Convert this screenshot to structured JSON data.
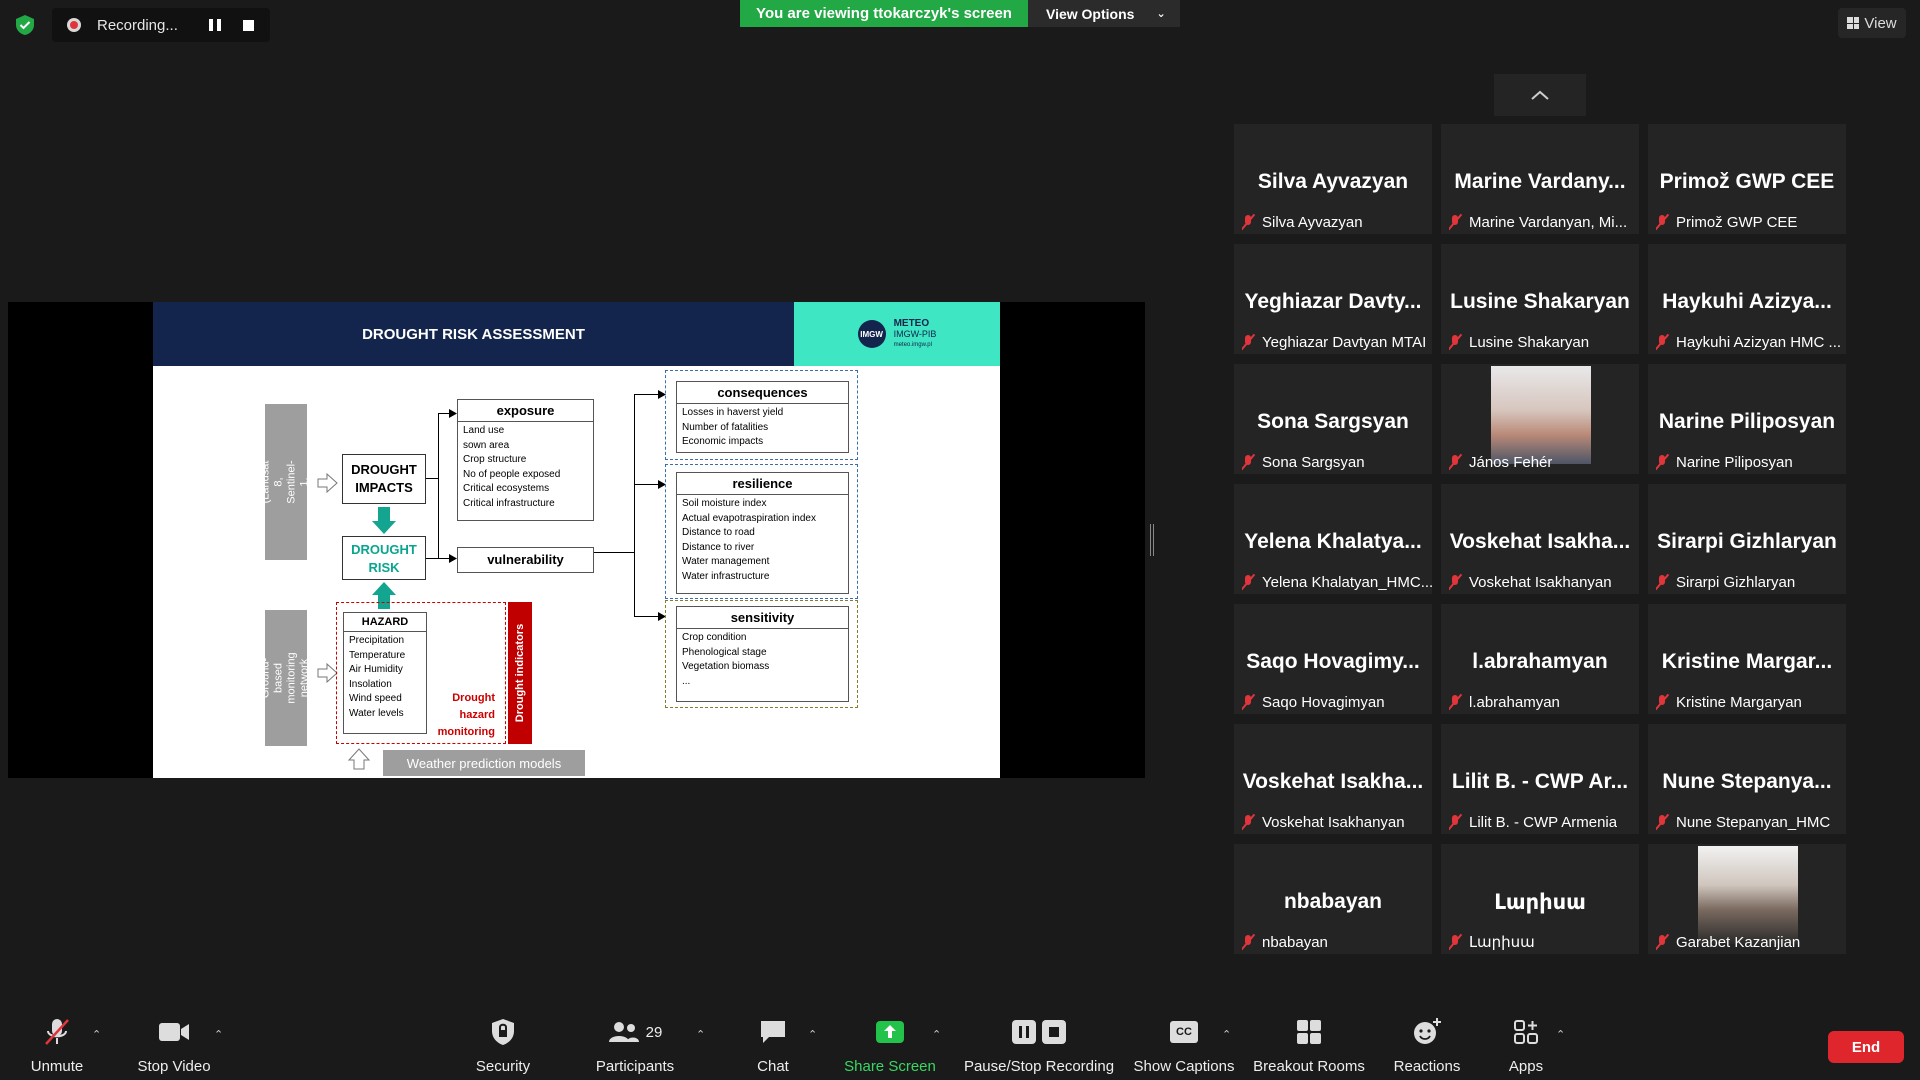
{
  "recording": {
    "label": "Recording..."
  },
  "banner": {
    "viewing": "You are viewing ttokarczyk's screen",
    "view_options": "View Options"
  },
  "view_button": {
    "label": "View"
  },
  "slide": {
    "title": "DROUGHT RISK ASSESSMENT",
    "logo_abbr": "IMGW",
    "logo_name": "METEO",
    "logo_sub": "IMGW-PIB",
    "logo_site": "meteo.imgw.pl",
    "satellite_label": "Satellite data (Landsat 8, Sentinel-1, Sentinel-2)",
    "ground_label": "Ground-based monitoring network",
    "drought_impacts_1": "DROUGHT",
    "drought_impacts_2": "IMPACTS",
    "drought_risk_1": "DROUGHT",
    "drought_risk_2": "RISK",
    "hazard_title": "HAZARD",
    "hazard_items": [
      "Precipitation",
      "Temperature",
      "Air Humidity",
      "Insolation",
      "Wind speed",
      "Water levels"
    ],
    "drought_hazard_monitoring_1": "Drought",
    "drought_hazard_monitoring_2": "hazard",
    "drought_hazard_monitoring_3": "monitoring",
    "drought_indicators": "Drought indicators",
    "exposure_title": "exposure",
    "exposure_items": [
      "Land use",
      "sown area",
      "Crop structure",
      "No of people exposed",
      "Critical ecosystems",
      "Critical infrastructure"
    ],
    "vulnerability_title": "vulnerability",
    "consequences_title": "consequences",
    "consequences_items": [
      "Losses in haverst yield",
      "Number of fatalities",
      "Economic impacts"
    ],
    "resilience_title": "resilience",
    "resilience_items": [
      "Soil moisture index",
      "Actual evapotraspiration index",
      "Distance to road",
      "Distance to river",
      "Water management",
      "Water infrastructure"
    ],
    "sensitivity_title": "sensitivity",
    "sensitivity_items": [
      "Crop condition",
      "Phenological stage",
      "Vegetation biomass",
      "..."
    ],
    "weather_models": "Weather prediction models"
  },
  "participants": [
    {
      "big": "Silva Ayvazyan",
      "small": "Silva Ayvazyan"
    },
    {
      "big": "Marine Vardany...",
      "small": "Marine Vardanyan, Mi..."
    },
    {
      "big": "Primož GWP CEE",
      "small": "Primož GWP CEE"
    },
    {
      "big": "Yeghiazar Davty...",
      "small": "Yeghiazar Davtyan MTAI"
    },
    {
      "big": "Lusine Shakaryan",
      "small": "Lusine Shakaryan"
    },
    {
      "big": "Haykuhi Azizya...",
      "small": "Haykuhi Azizyan HMC ..."
    },
    {
      "big": "Sona Sargsyan",
      "small": "Sona Sargsyan"
    },
    {
      "big": "",
      "small": "János Fehér",
      "photo": "elder-man-photo"
    },
    {
      "big": "Narine Piliposyan",
      "small": "Narine Piliposyan"
    },
    {
      "big": "Yelena Khalatya...",
      "small": "Yelena Khalatyan_HMC..."
    },
    {
      "big": "Voskehat Isakha...",
      "small": "Voskehat Isakhanyan"
    },
    {
      "big": "Sirarpi Gizhlaryan",
      "small": "Sirarpi Gizhlaryan"
    },
    {
      "big": "Saqo Hovagimy...",
      "small": "Saqo Hovagimyan"
    },
    {
      "big": "l.abrahamyan",
      "small": "l.abrahamyan"
    },
    {
      "big": "Kristine Margar...",
      "small": "Kristine Margaryan"
    },
    {
      "big": "Voskehat Isakha...",
      "small": "Voskehat Isakhanyan"
    },
    {
      "big": "Lilit B. - CWP Ar...",
      "small": "Lilit B. - CWP Armenia"
    },
    {
      "big": "Nune Stepanya...",
      "small": "Nune Stepanyan_HMC"
    },
    {
      "big": "nbabayan",
      "small": "nbabayan"
    },
    {
      "big": "Լարիսա",
      "small": "Լարիսա"
    },
    {
      "big": "",
      "small": "Garabet Kazanjian",
      "photo": "young-man-photo"
    }
  ],
  "toolbar": {
    "unmute": "Unmute",
    "stop_video": "Stop Video",
    "security": "Security",
    "participants": "Participants",
    "participants_count": "29",
    "chat": "Chat",
    "share_screen": "Share Screen",
    "pause_stop_recording": "Pause/Stop Recording",
    "show_captions": "Show Captions",
    "captions_icon": "CC",
    "breakout_rooms": "Breakout Rooms",
    "reactions": "Reactions",
    "apps": "Apps",
    "end": "End"
  }
}
